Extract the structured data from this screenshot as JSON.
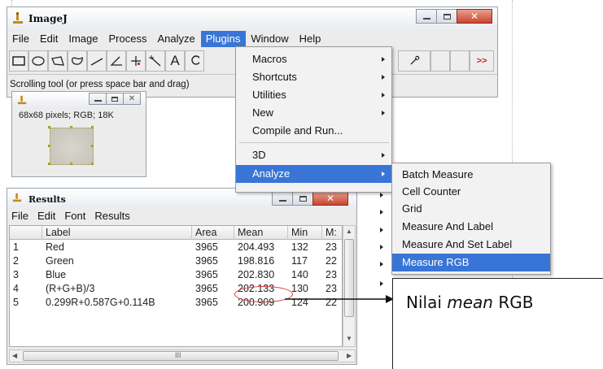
{
  "main_window": {
    "title": "ImageJ",
    "menus": [
      "File",
      "Edit",
      "Image",
      "Process",
      "Analyze",
      "Plugins",
      "Window",
      "Help"
    ],
    "active_menu_index": 5,
    "status": "Scrolling tool (or press space bar and drag)",
    "toolbar_more": ">>"
  },
  "image_window": {
    "info": "68x68 pixels; RGB; 18K"
  },
  "plugins_menu": {
    "items": [
      {
        "label": "Macros",
        "submenu": true
      },
      {
        "label": "Shortcuts",
        "submenu": true
      },
      {
        "label": "Utilities",
        "submenu": true
      },
      {
        "label": "New",
        "submenu": true
      },
      {
        "label": "Compile and Run...",
        "submenu": false
      },
      {
        "label": "3D",
        "submenu": true
      },
      {
        "label": "Analyze",
        "submenu": true
      }
    ]
  },
  "analyze_menu": {
    "items": [
      "Batch Measure",
      "Cell Counter",
      "Grid",
      "Measure And Label",
      "Measure And Set Label",
      "Measure RGB"
    ],
    "active_index": 5
  },
  "results_window": {
    "title": "Results",
    "menus": [
      "File",
      "Edit",
      "Font",
      "Results"
    ],
    "columns": [
      "",
      "Label",
      "Area",
      "Mean",
      "Min",
      "M:"
    ],
    "rows": [
      [
        "1",
        "Red",
        "3965",
        "204.493",
        "132",
        "23"
      ],
      [
        "2",
        "Green",
        "3965",
        "198.816",
        "117",
        "22"
      ],
      [
        "3",
        "Blue",
        "3965",
        "202.830",
        "140",
        "23"
      ],
      [
        "4",
        "(R+G+B)/3",
        "3965",
        "202.133",
        "130",
        "23"
      ],
      [
        "5",
        "0.299R+0.587G+0.114B",
        "3965",
        "200.909",
        "124",
        "22"
      ]
    ],
    "scroll_hint": "III"
  },
  "annotation": {
    "prefix": "Nilai ",
    "emphasis": "mean",
    "suffix": " RGB"
  },
  "colors": {
    "menu_highlight": "#3875d7",
    "highlight_ellipse": "#d73a3a"
  }
}
